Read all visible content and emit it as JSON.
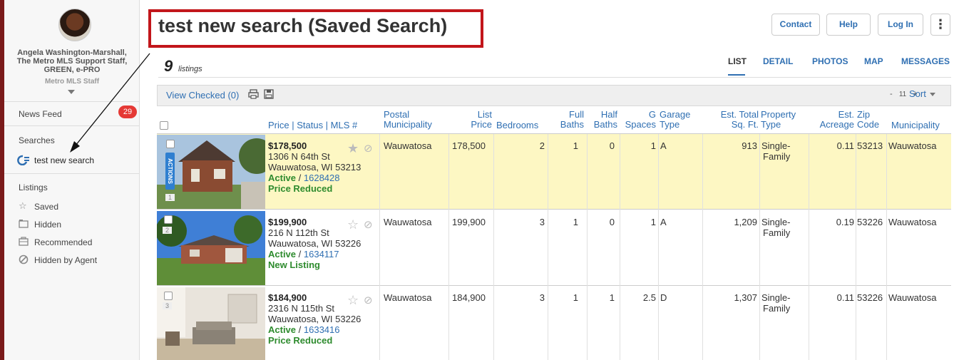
{
  "sidebar": {
    "agent_name": "Angela Washington-Marshall, The Metro MLS Support Staff, GREEN, e-PRO",
    "agent_name_lines": [
      "Angela Washington-Marshall,",
      "The Metro MLS Support Staff,",
      "GREEN, e-PRO"
    ],
    "agent_role": "Metro MLS Staff",
    "news_feed": "News Feed",
    "news_count": "29",
    "searches_header": "Searches",
    "search_item": "test new search",
    "listings_header": "Listings",
    "listing_items": [
      "Saved",
      "Hidden",
      "Recommended",
      "Hidden by Agent"
    ],
    "icons": [
      "search-refresh-icon",
      "star-icon",
      "folder-icon",
      "briefcase-icon",
      "hidden-circle-icon"
    ]
  },
  "header": {
    "title": "test new search (Saved Search)",
    "buttons": {
      "contact": "Contact",
      "help": "Help",
      "login": "Log In",
      "more": "⋮"
    },
    "count": "9",
    "count_label": "listings",
    "tabs": [
      "LIST",
      "DETAIL",
      "PHOTOS",
      "MAP",
      "MESSAGES"
    ],
    "active_tab": "LIST"
  },
  "toolbar": {
    "view_checked": "View Checked (0)",
    "pager_minus": "-",
    "pager_size": "11",
    "pager_plus": "+",
    "sort": "Sort"
  },
  "columns": {
    "price_status_mls": "Price | Status | MLS #",
    "postal_muni_1": "Postal",
    "postal_muni_2": "Municipality",
    "list_price_1": "List",
    "list_price_2": "Price",
    "bedrooms": "Bedrooms",
    "full_baths_1": "Full",
    "full_baths_2": "Baths",
    "half_baths_1": "Half",
    "half_baths_2": "Baths",
    "g_spaces_1": "G",
    "g_spaces_2": "Spaces",
    "garage_type_1": "Garage",
    "garage_type_2": "Type",
    "est_sqft_1": "Est. Total",
    "est_sqft_2": "Sq. Ft.",
    "prop_type_1": "Property",
    "prop_type_2": "Type",
    "est_acreage_1": "Est.",
    "est_acreage_2": "Acreage",
    "zip_1": "Zip",
    "zip_2": "Code",
    "municipality": "Municipality"
  },
  "listings": [
    {
      "num": "1",
      "price": "$178,500",
      "street": "1306 N 64th St",
      "city": "Wauwatosa, WI 53213",
      "status": "Active",
      "mls": "1628428",
      "note": "Price Reduced",
      "postal_muni": "Wauwatosa",
      "list_price": "178,500",
      "bedrooms": "2",
      "full_baths": "1",
      "half_baths": "0",
      "g_spaces": "1",
      "garage_type": "A",
      "sqft": "913",
      "prop_type_1": "Single-",
      "prop_type_2": "Family",
      "acreage": "0.11",
      "zip": "53213",
      "municipality": "Wauwatosa",
      "actions": "ACTIONS"
    },
    {
      "num": "2",
      "price": "$199,900",
      "street": "216 N 112th St",
      "city": "Wauwatosa, WI 53226",
      "status": "Active",
      "mls": "1634117",
      "note": "New Listing",
      "postal_muni": "Wauwatosa",
      "list_price": "199,900",
      "bedrooms": "3",
      "full_baths": "1",
      "half_baths": "0",
      "g_spaces": "1",
      "garage_type": "A",
      "sqft": "1,209",
      "prop_type_1": "Single-",
      "prop_type_2": "Family",
      "acreage": "0.19",
      "zip": "53226",
      "municipality": "Wauwatosa"
    },
    {
      "num": "3",
      "price": "$184,900",
      "street": "2316 N 115th St",
      "city": "Wauwatosa, WI 53226",
      "status": "Active",
      "mls": "1633416",
      "note": "Price Reduced",
      "postal_muni": "Wauwatosa",
      "list_price": "184,900",
      "bedrooms": "3",
      "full_baths": "1",
      "half_baths": "1",
      "g_spaces": "2.5",
      "garage_type": "D",
      "sqft": "1,307",
      "prop_type_1": "Single-",
      "prop_type_2": "Family",
      "acreage": "0.11",
      "zip": "53226",
      "municipality": "Wauwatosa"
    }
  ],
  "colors": {
    "accent": "#2f6fb2",
    "highlight": "#c2161b",
    "active_green": "#2e8b2e",
    "selected_row": "#fdf7c3"
  }
}
